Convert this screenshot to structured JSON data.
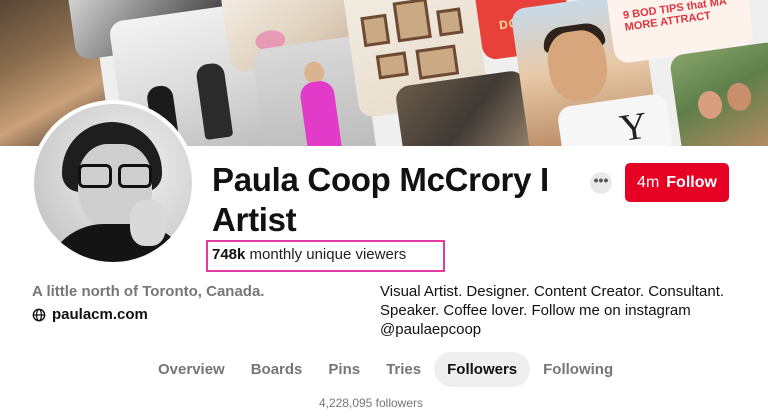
{
  "header_images": {
    "tile_texts": [
      "DO",
      "9 BOD TIPS that MA MORE ATTRACT",
      "Y"
    ]
  },
  "profile": {
    "name": "Paula Coop McCrory I Artist",
    "more_label": "•••",
    "follow": {
      "count": "4m",
      "label": "Follow",
      "color": "#e60023"
    },
    "viewers": {
      "count": "748k",
      "text": "monthly unique viewers",
      "highlight_color": "#e23aa4"
    },
    "location": "A little north of Toronto, Canada.",
    "website": {
      "icon": "globe-icon",
      "url": "paulacm.com"
    },
    "bio": "Visual Artist. Designer. Content Creator. Consultant. Speaker. Coffee lover. Follow me on instagram @paulaepcoop"
  },
  "tabs": [
    {
      "label": "Overview",
      "active": false
    },
    {
      "label": "Boards",
      "active": false
    },
    {
      "label": "Pins",
      "active": false
    },
    {
      "label": "Tries",
      "active": false
    },
    {
      "label": "Followers",
      "active": true
    },
    {
      "label": "Following",
      "active": false
    }
  ],
  "followers_count": "4,228,095 followers"
}
